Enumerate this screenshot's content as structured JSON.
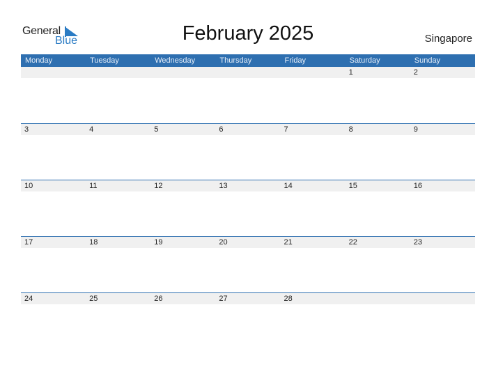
{
  "logo": {
    "line1": "General",
    "line2": "Blue"
  },
  "title": "February 2025",
  "country": "Singapore",
  "weekdays": [
    "Monday",
    "Tuesday",
    "Wednesday",
    "Thursday",
    "Friday",
    "Saturday",
    "Sunday"
  ],
  "weeks": [
    [
      "",
      "",
      "",
      "",
      "",
      "1",
      "2"
    ],
    [
      "3",
      "4",
      "5",
      "6",
      "7",
      "8",
      "9"
    ],
    [
      "10",
      "11",
      "12",
      "13",
      "14",
      "15",
      "16"
    ],
    [
      "17",
      "18",
      "19",
      "20",
      "21",
      "22",
      "23"
    ],
    [
      "24",
      "25",
      "26",
      "27",
      "28",
      "",
      ""
    ]
  ],
  "colors": {
    "accent": "#2e6fb0",
    "row_bg": "#f0f0f0",
    "logo_blue": "#2a7bc4"
  }
}
